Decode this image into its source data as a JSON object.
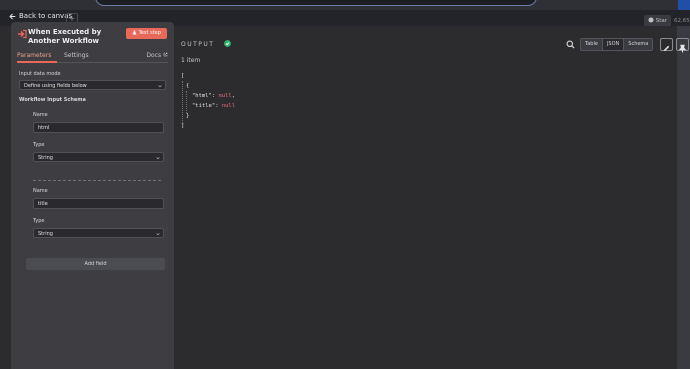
{
  "nav": {
    "back_label": "Back to canvas",
    "new_tab": "+",
    "star_label": "Star",
    "count_label": "62,65"
  },
  "node": {
    "title": "When Executed by Another Workflow",
    "test_step_label": "Test step",
    "tabs": [
      "Parameters",
      "Settings"
    ],
    "docs_label": "Docs"
  },
  "params": {
    "input_mode_label": "Input data mode",
    "input_mode_value": "Define using fields below",
    "schema_label": "Workflow Input Schema",
    "fields": [
      {
        "name_label": "Name",
        "name_value": "html",
        "type_label": "Type",
        "type_value": "String"
      },
      {
        "name_label": "Name",
        "name_value": "title",
        "type_label": "Type",
        "type_value": "String"
      }
    ],
    "add_field_label": "Add field"
  },
  "output": {
    "label": "OUTPUT",
    "items_count": "1 item",
    "view_modes": [
      "Table",
      "JSON",
      "Schema"
    ],
    "selected_view": "JSON",
    "json_lines": [
      "[",
      "{",
      "}",
      "]"
    ],
    "json_keys": [
      "\"html\"",
      "\"title\""
    ],
    "json_values": [
      "null",
      "null"
    ],
    "colon": ":",
    "comma": ","
  },
  "icons": {
    "back": "arrow-left-icon",
    "trigger": "sign-in-arrow-icon",
    "flask": "flask-icon",
    "external": "external-link-icon",
    "check": "check-circle-icon",
    "search": "search-icon",
    "edit": "pencil-icon",
    "pin": "pin-icon",
    "github": "github-icon",
    "caret": "chevron-down-icon"
  },
  "colors": {
    "accent": "#e8695a",
    "success": "#2fb36b",
    "null_value": "#e5747d"
  }
}
